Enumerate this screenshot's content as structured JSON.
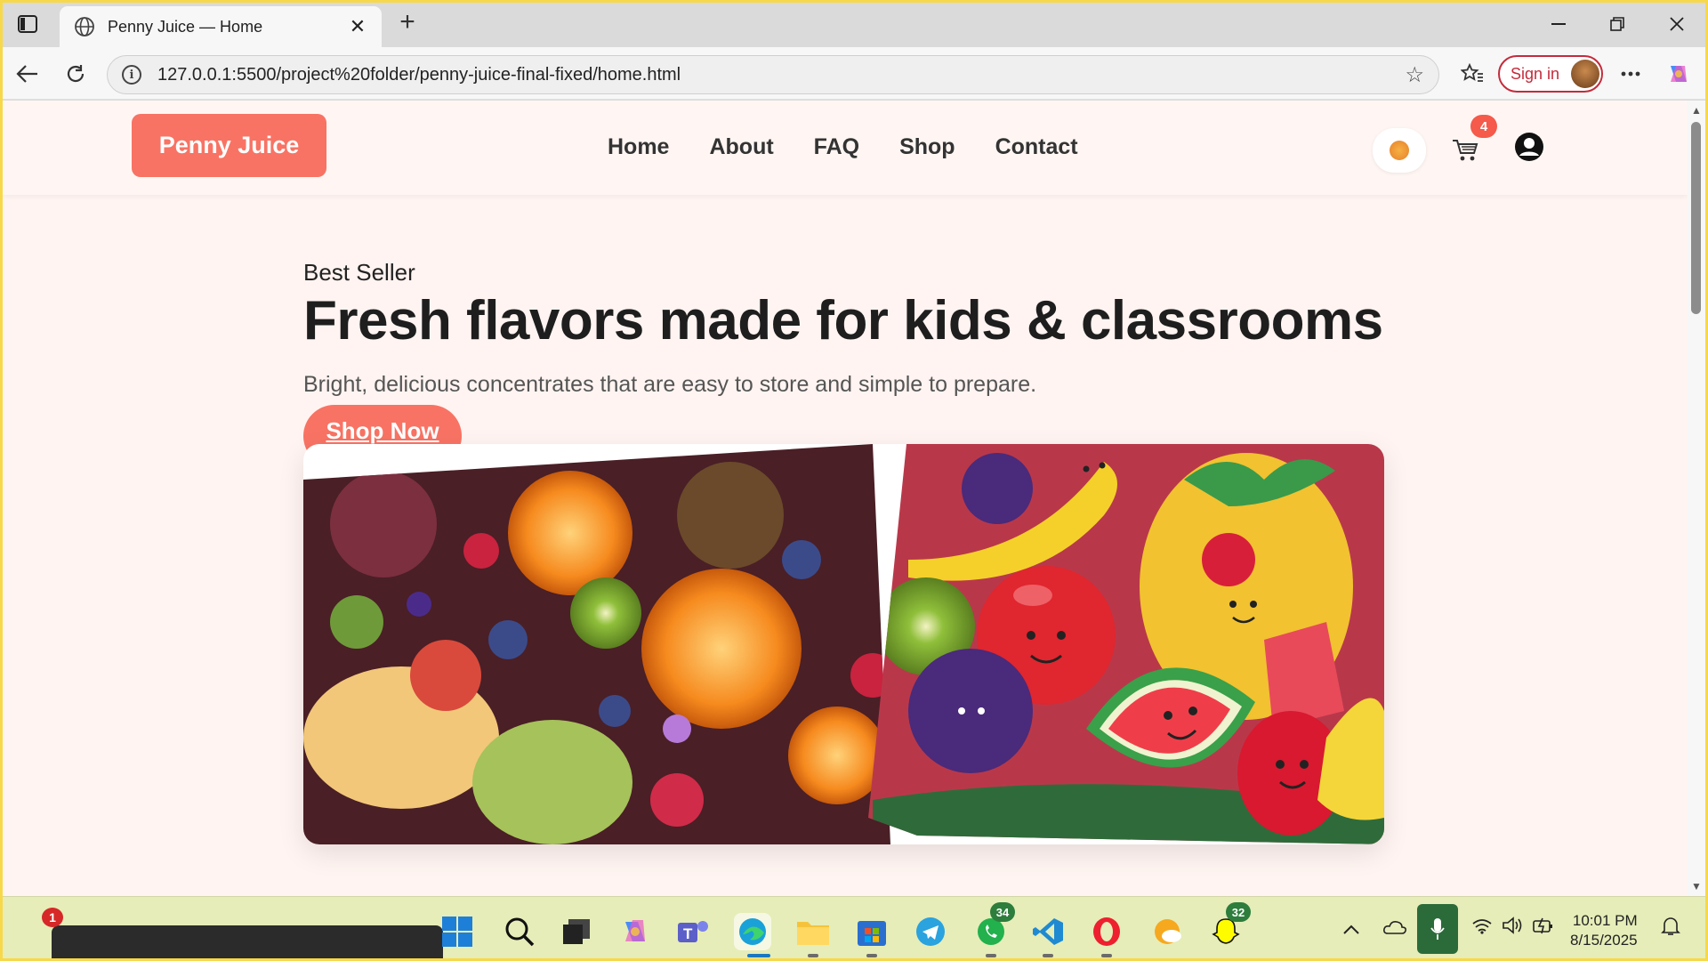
{
  "browser": {
    "tab_title": "Penny Juice — Home",
    "url": "127.0.0.1:5500/project%20folder/penny-juice-final-fixed/home.html",
    "sign_in_label": "Sign in",
    "new_tab_label": "+",
    "close_tab_label": "✕"
  },
  "site": {
    "logo": "Penny Juice",
    "nav": [
      "Home",
      "About",
      "FAQ",
      "Shop",
      "Contact"
    ],
    "cart_count": "4"
  },
  "hero": {
    "kicker": "Best Seller",
    "title": "Fresh flavors made for kids & classrooms",
    "subtitle": "Bright, delicious concentrates that are easy to store and simple to prepare.",
    "cta": "Shop Now"
  },
  "taskbar": {
    "notification_count": "1",
    "whatsapp_count": "34",
    "snapchat_count": "32",
    "time": "10:01 PM",
    "date": "8/15/2025"
  },
  "colors": {
    "brand": "#f87364",
    "page_bg": "#fff4f1",
    "taskbar_bg": "#e6edb8"
  }
}
